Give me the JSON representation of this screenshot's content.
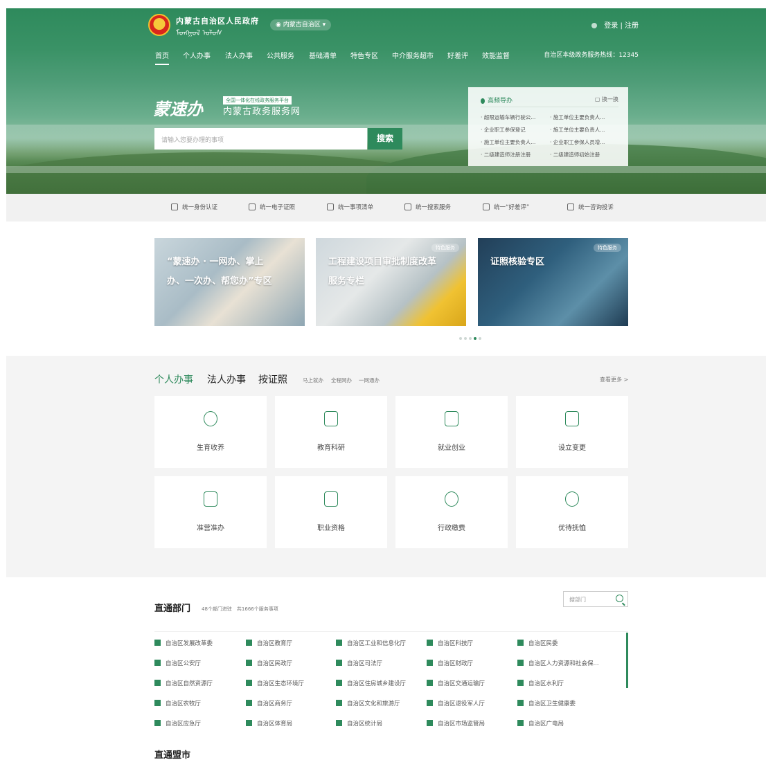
{
  "header": {
    "gov_name": "内蒙古自治区人民政府",
    "gov_mongol": "ᠮᠣᠩᠭᠣᠯ ᠤᠯᠤᠰ",
    "region": "内蒙古自治区",
    "login": "登录 | 注册",
    "hotline": "自治区本级政务服务热线：12345",
    "nav": [
      "首页",
      "个人办事",
      "法人办事",
      "公共服务",
      "基础清单",
      "特色专区",
      "中介服务超市",
      "好差评",
      "效能监督"
    ]
  },
  "brand": {
    "logo": "蒙速办",
    "tagline": "全国一体化在线政务服务平台",
    "title": "内蒙古政务服务网"
  },
  "search": {
    "placeholder": "请输入您要办理的事项",
    "button": "搜索"
  },
  "hot": {
    "title": "高频导办",
    "switch": "换一换",
    "items": [
      "超限运输车辆行驶公...",
      "施工单位主要负责人...",
      "企业职工参保登记",
      "施工单位主要负责人...",
      "施工单位主要负责人...",
      "企业职工参保人员增...",
      "二级建造师注册注册",
      "二级建造师初始注册"
    ]
  },
  "strip": [
    "统一身份认证",
    "统一电子证照",
    "统一事项清单",
    "统一搜索服务",
    "统一“好差评”",
    "统一咨询投诉"
  ],
  "banners": [
    {
      "text1": "“蒙速办 · 一网办、掌上",
      "text2": "办、一次办、帮您办”专区",
      "badge": ""
    },
    {
      "text1": "工程建设项目审批制度改革",
      "text2": "服务专栏",
      "badge": "特色服务"
    },
    {
      "text1": "证照核验专区",
      "text2": "",
      "badge": "特色服务"
    }
  ],
  "services": {
    "tabs": [
      "个人办事",
      "法人办事",
      "按证照"
    ],
    "subs": [
      "马上就办",
      "全程网办",
      "一网通办"
    ],
    "more": "查看更多 >",
    "cards": [
      "生育收养",
      "教育科研",
      "就业创业",
      "设立变更",
      "准营准办",
      "职业资格",
      "行政缴费",
      "优待抚恤"
    ],
    "icons": [
      "baby-icon",
      "education-icon",
      "employment-icon",
      "register-change-icon",
      "license-icon",
      "qualification-icon",
      "payment-icon",
      "care-icon"
    ]
  },
  "departments": {
    "title": "直通部门",
    "stats": "48个部门进驻　共1666个服务事项",
    "search_placeholder": "搜部门",
    "items": [
      "自治区发展改革委",
      "自治区教育厅",
      "自治区工业和信息化厅",
      "自治区科技厅",
      "自治区民委",
      "自治区公安厅",
      "自治区民政厅",
      "自治区司法厅",
      "自治区财政厅",
      "自治区人力资源和社会保...",
      "自治区自然资源厅",
      "自治区生态环境厅",
      "自治区住房城乡建设厅",
      "自治区交通运输厅",
      "自治区水利厅",
      "自治区农牧厅",
      "自治区商务厅",
      "自治区文化和旅游厅",
      "自治区退役军人厅",
      "自治区卫生健康委",
      "自治区应急厅",
      "自治区体育局",
      "自治区统计局",
      "自治区市场监管局",
      "自治区广电局"
    ]
  },
  "league": {
    "title": "直通盟市"
  },
  "colors": {
    "primary": "#2e8a5c"
  }
}
